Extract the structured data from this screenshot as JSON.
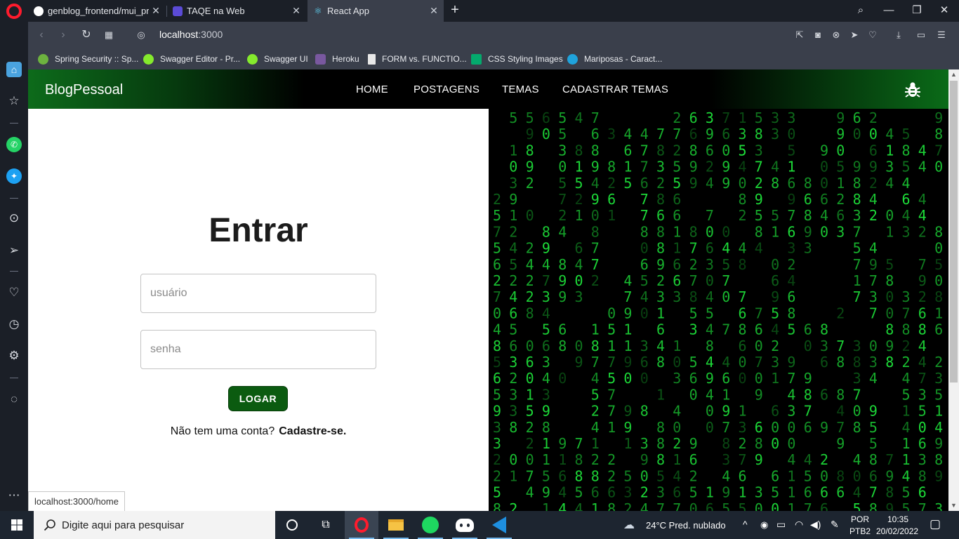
{
  "browser": {
    "tabs": [
      {
        "title": "genblog_frontend/mui_pri",
        "active": false
      },
      {
        "title": "TAQE na Web",
        "active": false
      },
      {
        "title": "React App",
        "active": true
      }
    ],
    "url_host": "localhost",
    "url_port": ":3000",
    "status_url": "localhost:3000/home",
    "bookmarks": [
      {
        "label": "Spring Security :: Sp...",
        "color": "#6db33f"
      },
      {
        "label": "Swagger Editor - Pr...",
        "color": "#85ea2d"
      },
      {
        "label": "Swagger UI",
        "color": "#85ea2d"
      },
      {
        "label": "Heroku",
        "color": "#79589f"
      },
      {
        "label": "FORM vs. FUNCTIO...",
        "color": "#e8e8e8"
      },
      {
        "label": "CSS Styling Images",
        "color": "#04aa6d"
      },
      {
        "label": "Mariposas - Caract...",
        "color": "#1fa3dc"
      }
    ]
  },
  "app": {
    "brand": "BlogPessoal",
    "nav": [
      "HOME",
      "POSTAGENS",
      "TEMAS",
      "CADASTRAR TEMAS"
    ],
    "login": {
      "title": "Entrar",
      "username_placeholder": "usuário",
      "password_placeholder": "senha",
      "button_label": "LOGAR",
      "signup_prompt": "Não tem uma conta?",
      "signup_link": "Cadastre-se."
    }
  },
  "taskbar": {
    "search_placeholder": "Digite aqui para pesquisar",
    "weather": "24°C  Pred. nublado",
    "lang_top": "POR",
    "lang_bottom": "PTB2",
    "time": "10:35",
    "date": "20/02/2022"
  },
  "colors": {
    "accent_green": "#0b5b10",
    "matrix_green": "#1ee03a"
  }
}
